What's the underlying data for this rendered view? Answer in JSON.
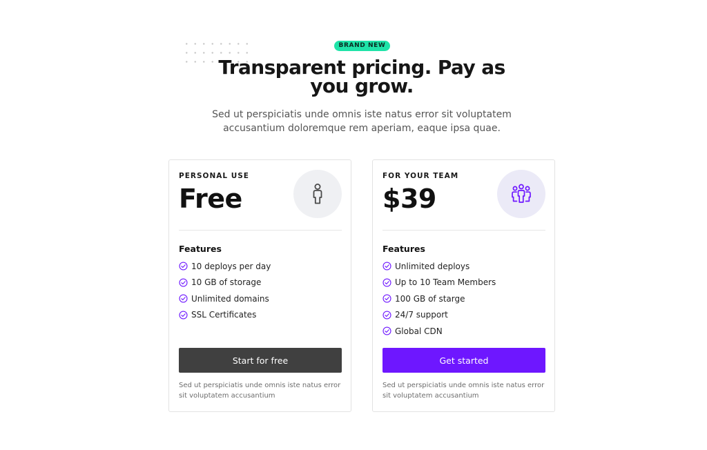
{
  "hero": {
    "badge": "BRAND NEW",
    "title": "Transparent pricing. Pay as you grow.",
    "subtitle": "Sed ut perspiciatis unde omnis iste natus error sit voluptatem accusantium doloremque rem aperiam, eaque ipsa quae."
  },
  "colors": {
    "badge_bg": "#1fe3a8",
    "accent": "#6e17ff",
    "dark_button": "#404040"
  },
  "plans": [
    {
      "tier": "PERSONAL USE",
      "price": "Free",
      "icon": "person-icon",
      "features_heading": "Features",
      "features": [
        "10 deploys per day",
        "10 GB of storage",
        "Unlimited domains",
        "SSL Certificates"
      ],
      "cta": "Start for free",
      "note": "Sed ut perspiciatis unde omnis iste natus error sit voluptatem accusantium"
    },
    {
      "tier": "FOR YOUR TEAM",
      "price": "$39",
      "icon": "team-icon",
      "features_heading": "Features",
      "features": [
        "Unlimited deploys",
        "Up to 10 Team Members",
        "100 GB of starge",
        "24/7 support",
        "Global CDN"
      ],
      "cta": "Get started",
      "note": "Sed ut perspiciatis unde omnis iste natus error sit voluptatem accusantium"
    }
  ]
}
